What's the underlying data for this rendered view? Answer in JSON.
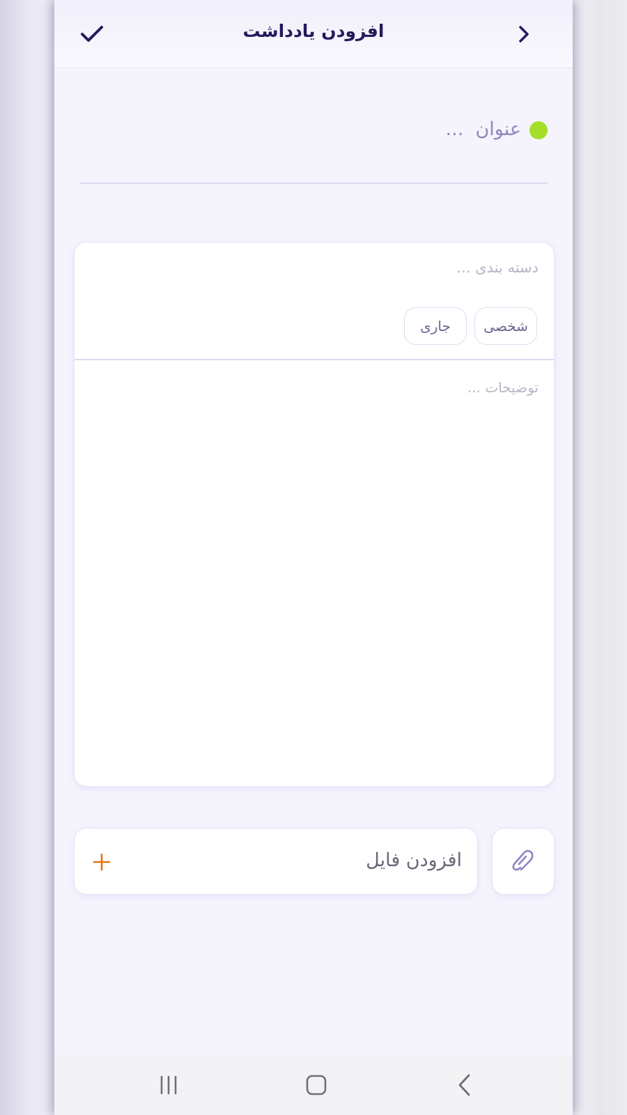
{
  "header": {
    "title": "افزودن یادداشت",
    "confirm_icon": "check-icon",
    "back_icon": "chevron-right-icon"
  },
  "note_title": {
    "placeholder": "عنوان  ...",
    "value": "",
    "color_dot": "#a6de2a"
  },
  "category": {
    "label": "دسته بندی  ...",
    "chips": [
      {
        "label": "شخصی"
      },
      {
        "label": "جاری"
      }
    ]
  },
  "description": {
    "placeholder": "توضیحات ...",
    "value": ""
  },
  "attachment": {
    "add_file_label": "افزودن فایل",
    "plus_icon": "plus-icon",
    "attach_icon": "paperclip-icon"
  },
  "system_nav": {
    "recents_icon": "recents-icon",
    "home_icon": "home-icon",
    "back_icon": "back-icon"
  },
  "colors": {
    "primary": "#241a5e",
    "accent": "#a6de2a",
    "plus": "#e8720c",
    "background": "#f5f4fd"
  }
}
